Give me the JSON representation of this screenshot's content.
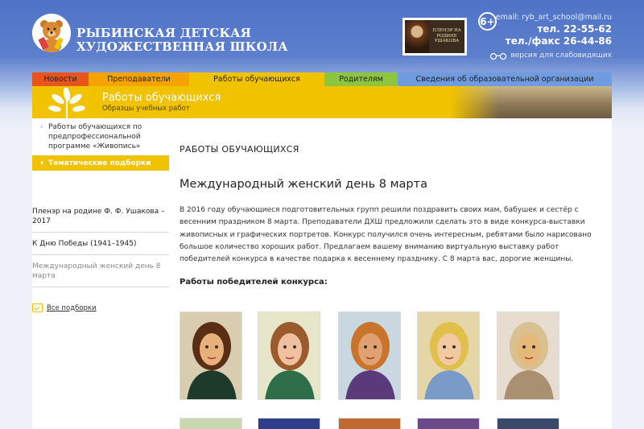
{
  "header": {
    "school_name_line1": "РЫБИНСКАЯ ДЕТСКАЯ",
    "school_name_line2": "ХУДОЖЕСТВЕННАЯ ШКОЛА",
    "banner_text": "ПЛЕНЭР НА РОДИНЕ УШАКОВА",
    "age_rating": "6+",
    "email": "email: ryb_art_school@mail.ru",
    "phone": "тел. 22-55-62",
    "fax": "тел./факс 26-44-86",
    "accessible_version": "версия для слабовидящих"
  },
  "nav": [
    {
      "label": "Новости",
      "color": "#e8541c",
      "width": 70
    },
    {
      "label": "Преподаватели",
      "color": "#f4a300",
      "width": 125
    },
    {
      "label": "Работы обучающихся",
      "color": "#f0c200",
      "width": 168
    },
    {
      "label": "Родителям",
      "color": "#8cc63e",
      "width": 91
    },
    {
      "label": "Сведения об образовательной организации",
      "color": "#6f9be0",
      "width": 266
    }
  ],
  "subheader": {
    "title": "Работы обучающихся",
    "subtitle": "Образцы учебных работ"
  },
  "sidebar": {
    "program_link": "Работы обучающихся по предпрофессиональной программе «Живопись»",
    "active_label": "Тематические подборки",
    "items": [
      {
        "label": "Пленэр на родине Ф. Ф. Ушакова – 2017",
        "muted": false
      },
      {
        "label": "К Дню Победы (1941–1945)",
        "muted": false
      },
      {
        "label": "Международный женский день 8 марта",
        "muted": true
      }
    ],
    "all_selections": "Все подборки"
  },
  "content": {
    "section_heading": "РАБОТЫ ОБУЧАЮЩИХСЯ",
    "article_title": "Международный женский день 8 марта",
    "article_text": "В 2016 году обучающиеся подготовительных групп решили поздравить своих мам, бабушек и сестёр с весенним праздником 8 марта. Преподаватели ДХШ предложили сделать это в виде конкурса-выставки живописных и графических портретов. Конкурс получился очень интересным, ребятами было нарисовано большое количество хороших работ. Предлагаем вашему вниманию виртуальную выставку работ победителей конкурса в качестве подарка к весеннему празднику. С 8 марта вас, дорогие женщины.",
    "winners_title": "Работы победителей конкурса:"
  },
  "gallery": [
    {
      "name": "portrait-hat",
      "bg": "#d9cdb0",
      "face": "#e8b07a",
      "hair": "#5a2e14",
      "cloth": "#1d3a2a"
    },
    {
      "name": "portrait-pink-cheeks",
      "bg": "#e8e6c8",
      "face": "#f0c0a0",
      "hair": "#9b5a2c",
      "cloth": "#2f6e4a"
    },
    {
      "name": "portrait-winter",
      "bg": "#c9d7e0",
      "face": "#e0a070",
      "hair": "#c8742a",
      "cloth": "#5a3a7a"
    },
    {
      "name": "portrait-blonde",
      "bg": "#e5d6a8",
      "face": "#f2c9a0",
      "hair": "#e0c04a",
      "cloth": "#7a9ac8"
    },
    {
      "name": "portrait-dreamy",
      "bg": "#e6dccf",
      "face": "#e6b87a",
      "hair": "#d8c090",
      "cloth": "#a89070"
    }
  ]
}
